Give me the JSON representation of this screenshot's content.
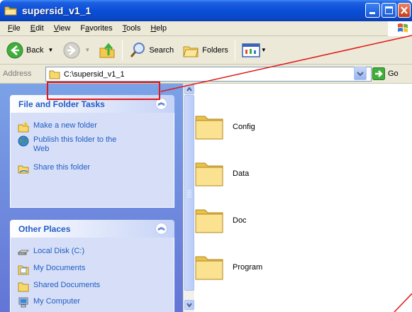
{
  "window": {
    "title": "supersid_v1_1"
  },
  "menu": [
    {
      "label": "File",
      "key": "F",
      "rest": "ile"
    },
    {
      "label": "Edit",
      "key": "E",
      "rest": "dit"
    },
    {
      "label": "View",
      "key": "V",
      "rest": "iew"
    },
    {
      "label": "Favorites",
      "key": "a",
      "pre": "F",
      "rest": "vorites"
    },
    {
      "label": "Tools",
      "key": "T",
      "rest": "ools"
    },
    {
      "label": "Help",
      "key": "H",
      "rest": "elp"
    }
  ],
  "toolbar": {
    "back_label": "Back",
    "search_label": "Search",
    "folders_label": "Folders"
  },
  "address": {
    "label": "Address",
    "value": "C:\\supersid_v1_1",
    "go_label": "Go"
  },
  "left_pane": {
    "file_tasks": {
      "title": "File and Folder Tasks",
      "items": [
        {
          "label": "Make a new folder"
        },
        {
          "label": "Publish this folder to the Web"
        },
        {
          "label": "Share this folder"
        }
      ]
    },
    "other_places": {
      "title": "Other Places",
      "items": [
        {
          "label": "Local Disk (C:)"
        },
        {
          "label": "My Documents"
        },
        {
          "label": "Shared Documents"
        },
        {
          "label": "My Computer"
        }
      ]
    }
  },
  "folders": [
    {
      "name": "Config"
    },
    {
      "name": "Data"
    },
    {
      "name": "Doc"
    },
    {
      "name": "Program"
    }
  ],
  "colors": {
    "title_bar": "#0a4fd8",
    "task_link": "#215dc6",
    "annotation": "#e21616"
  }
}
